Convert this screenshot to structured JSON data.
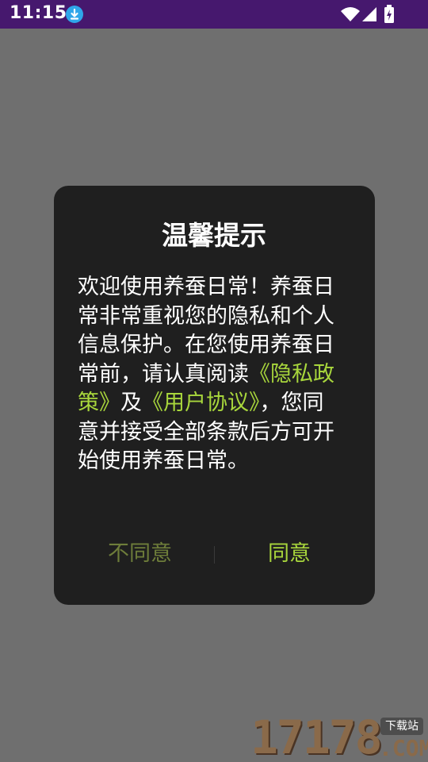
{
  "status_bar": {
    "time": "11:15",
    "icons": [
      "download-icon",
      "wifi-icon",
      "signal-icon",
      "battery-icon"
    ]
  },
  "dialog": {
    "title": "温馨提示",
    "body": {
      "intro": "欢迎使用养蚕日常！养蚕日常非常重视您的隐私和个人信息保护。在您使用养蚕日常前，请认真阅读",
      "privacy_link": "《隐私政策》",
      "conjunction": "及",
      "agreement_link": "《用户协议》",
      "outro": "，您同意并接受全部条款后方可开始使用养蚕日常。"
    },
    "buttons": {
      "disagree": "不同意",
      "agree": "同意"
    }
  },
  "watermark": {
    "number": "17178",
    "badge": "下载站",
    "domain": ".COM"
  },
  "colors": {
    "status_bar_bg": "#46186e",
    "overlay": "#6f6f6f",
    "dialog_bg": "#1f1f1f",
    "accent": "#a8d63c",
    "disagree_text": "#6e7d3a"
  }
}
